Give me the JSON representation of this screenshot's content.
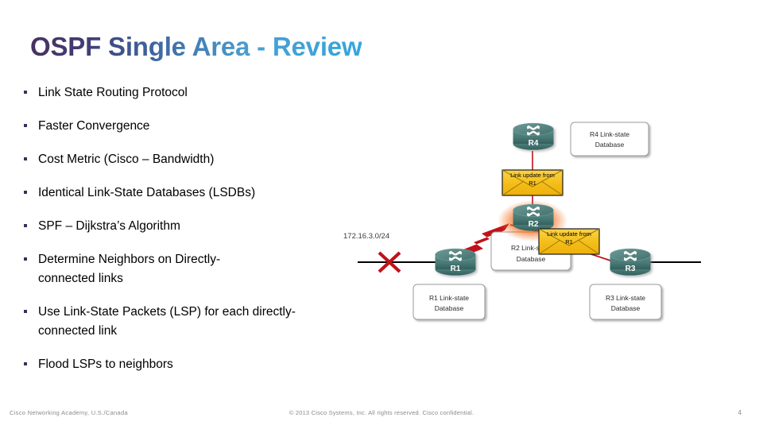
{
  "slide": {
    "title": "OSPF Single Area - Review",
    "page_number": "4",
    "title_gradient_from": "#473060",
    "title_gradient_to": "#34a6dd",
    "bullet_marker_color": "#3b2f57"
  },
  "bullets": [
    {
      "text": "Link State Routing Protocol"
    },
    {
      "text": "Faster Convergence"
    },
    {
      "text": "Cost Metric (Cisco – Bandwidth)"
    },
    {
      "text": "Identical Link-State Databases (LSDBs)"
    },
    {
      "text": "SPF – Dijkstra’s Algorithm"
    },
    {
      "text": "Determine Neighbors on Directly-connected links"
    },
    {
      "text": "Use Link-State Packets (LSP) for each directly-connected link"
    },
    {
      "text": "Flood LSPs to neighbors"
    }
  ],
  "diagram": {
    "routers": [
      {
        "id": "r4",
        "label": "R4",
        "highlight": "none"
      },
      {
        "id": "r2",
        "label": "R2",
        "highlight": "orange-glow"
      },
      {
        "id": "r1",
        "label": "R1",
        "highlight": "none"
      },
      {
        "id": "r3",
        "label": "R3",
        "highlight": "none"
      }
    ],
    "databases": [
      {
        "id": "r4-db",
        "line1": "R4 Link-state",
        "line2": "Database"
      },
      {
        "id": "r2-db",
        "line1": "R2 Link-state",
        "line2": "Database"
      },
      {
        "id": "r1-db",
        "line1": "R1 Link-state",
        "line2": "Database"
      },
      {
        "id": "r3-db",
        "line1": "R3 Link-state",
        "line2": "Database"
      }
    ],
    "envelopes": [
      {
        "id": "env-r4",
        "line1": "Link update from",
        "line2": "R1"
      },
      {
        "id": "env-r2",
        "line1": "Link update from",
        "line2": "R1"
      }
    ],
    "network_label": "172.16.3.0/24",
    "link_down_marker": "red-x",
    "router_body_color": "#4c7c79",
    "router_top_color": "#5d8f8b",
    "envelope_color": "#f5bf1c",
    "glow_color": "#f26a10",
    "update_arrow_color": "#c0121a"
  },
  "footer": {
    "left": "Cisco Networking Academy, U.S./Canada",
    "center": "© 2013 Cisco Systems, Inc. All rights reserved. Cisco confidential."
  }
}
